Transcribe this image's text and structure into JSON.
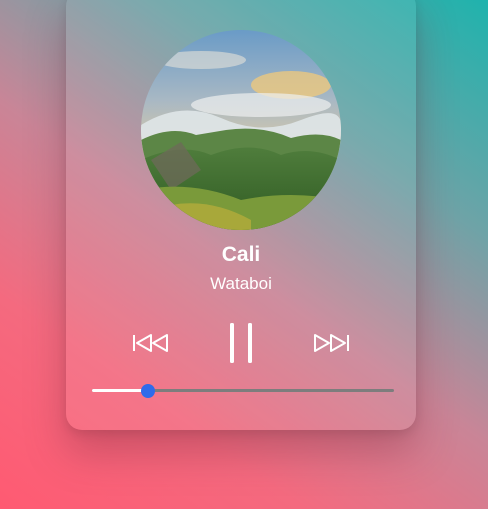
{
  "track": {
    "title": "Cali",
    "artist": "Wataboi"
  },
  "controls": {
    "prev_icon": "skip-back-icon",
    "pause_icon": "pause-icon",
    "next_icon": "skip-forward-icon"
  },
  "progress": {
    "fraction": 0.185
  },
  "colors": {
    "accent": "#2f6bea",
    "track_fill": "#ffffff",
    "track_empty": "#7d7d7d",
    "text": "#ffffff"
  }
}
